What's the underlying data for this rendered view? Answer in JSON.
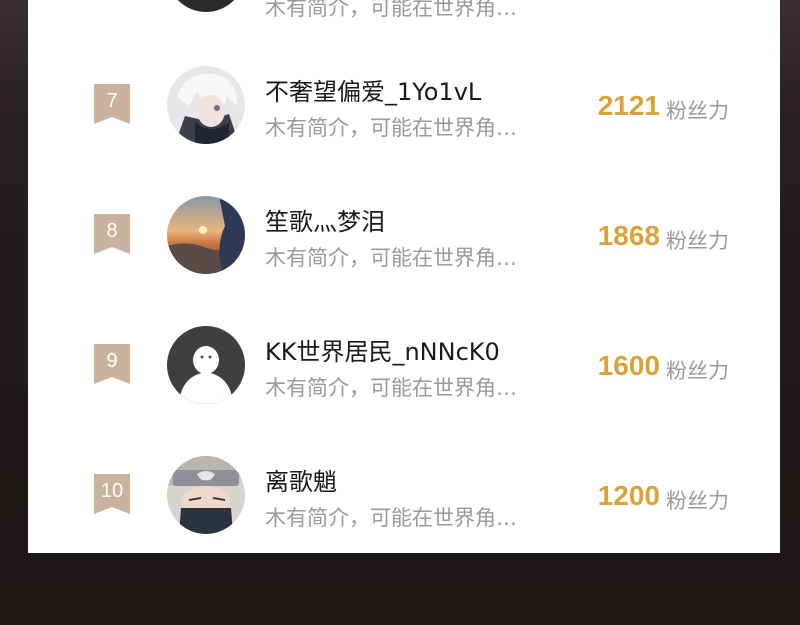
{
  "colors": {
    "accent": "#dba23a",
    "rank_badge": "#c9b39f",
    "panel": "#ffffff"
  },
  "top_partial": {
    "bio": "木有简介，可能在世界角…"
  },
  "rows": [
    {
      "rank": "7",
      "name": "不奢望偏爱_1Yo1vL",
      "bio": "木有简介，可能在世界角…",
      "score": "2121",
      "unit": "粉丝力",
      "avatar_icon": "anime-white-hair-avatar"
    },
    {
      "rank": "8",
      "name": "笙歌灬梦泪",
      "bio": "木有简介，可能在世界角…",
      "score": "1868",
      "unit": "粉丝力",
      "avatar_icon": "sunset-landscape-avatar"
    },
    {
      "rank": "9",
      "name": "KK世界居民_nNNcK0",
      "bio": "木有简介，可能在世界角…",
      "score": "1600",
      "unit": "粉丝力",
      "avatar_icon": "default-user-avatar"
    },
    {
      "rank": "10",
      "name": "离歌魈",
      "bio": "木有简介，可能在世界角…",
      "score": "1200",
      "unit": "粉丝力",
      "avatar_icon": "anime-masked-ninja-avatar"
    }
  ]
}
